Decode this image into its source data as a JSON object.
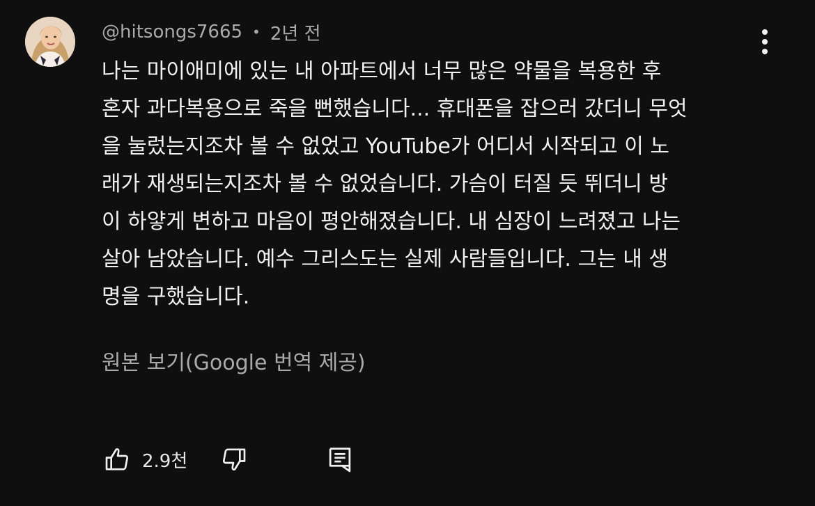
{
  "comment": {
    "author": "@hitsongs7665",
    "separator": "•",
    "time": "2년 전",
    "lines": [
      "나는 마이애미에 있는 내 아파트에서 너무 많은 약물을 복용한 후",
      "혼자 과다복용으로 죽을 뻔했습니다... 휴대폰을 잡으러 갔더니 무엇",
      "을 눌렀는지조차 볼 수 없었고 YouTube가 어디서 시작되고 이 노",
      "래가 재생되는지조차 볼 수 없었습니다. 가슴이 터질 듯 뛰더니 방",
      "이 하얗게 변하고 마음이 평안해졌습니다. 내 심장이 느려졌고 나는",
      "살아 남았습니다. 예수 그리스도는 실제 사람들입니다. 그는 내 생",
      "명을 구했습니다."
    ],
    "translate_link": "원본 보기(Google 번역 제공)",
    "like_count": "2.9천"
  },
  "icons": {
    "avatar": "user-avatar",
    "more": "more-vertical-icon",
    "like": "thumbs-up-icon",
    "dislike": "thumbs-down-icon",
    "reply": "reply-comment-icon"
  },
  "colors": {
    "background": "#0f0f0f",
    "primary_text": "#f1f1f1",
    "secondary_text": "#aaaaaa"
  }
}
